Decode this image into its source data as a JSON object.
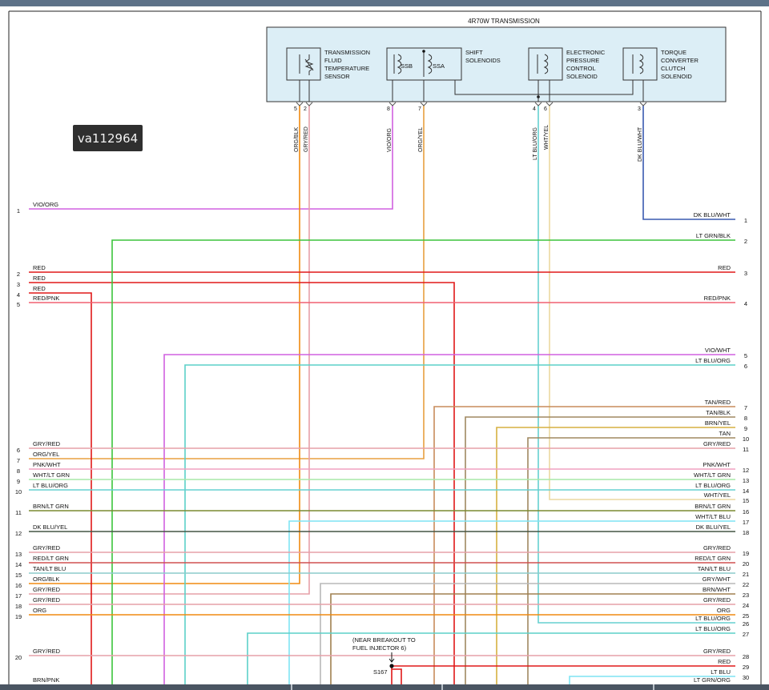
{
  "watermark": "va112964",
  "header": {
    "transmission_title": "4R70W TRANSMISSION",
    "components": [
      {
        "id": "tft",
        "lines": [
          "TRANSMISSION",
          "FLUID",
          "TEMPERATURE",
          "SENSOR"
        ]
      },
      {
        "id": "shift",
        "lines": [
          "SHIFT",
          "SOLENOIDS"
        ]
      },
      {
        "id": "epc",
        "lines": [
          "ELECTRONIC",
          "PRESSURE",
          "CONTROL",
          "SOLENOID"
        ]
      },
      {
        "id": "tcc",
        "lines": [
          "TORQUE",
          "CONVERTER",
          "CLUTCH",
          "SOLENOID"
        ]
      }
    ],
    "solenoid_labels": [
      "SSB",
      "SSA"
    ]
  },
  "pins": [
    {
      "num": "5",
      "wire": "ORG/BLK",
      "color": "#e8901a"
    },
    {
      "num": "2",
      "wire": "GRY/RED",
      "color": "#e6a0a8"
    },
    {
      "num": "8",
      "wire": "VIO/ORG",
      "color": "#e05aa8"
    },
    {
      "num": "7",
      "wire": "ORG/YEL",
      "color": "#e8a040"
    },
    {
      "num": "4",
      "wire": "LT BLU/ORG",
      "color": "#7fd8d8"
    },
    {
      "num": "6",
      "wire": "WHT/YEL",
      "color": "#ead9a0"
    },
    {
      "num": "3",
      "wire": "DK BLU/WHT",
      "color": "#4060b0"
    }
  ],
  "left_circuits": [
    {
      "num": "1",
      "label": "VIO/ORG"
    },
    {
      "num": "2",
      "label": "RED"
    },
    {
      "num": "3",
      "label": "RED"
    },
    {
      "num": "4",
      "label": "RED"
    },
    {
      "num": "5",
      "label": "RED/PNK"
    },
    {
      "num": "6",
      "label": "GRY/RED"
    },
    {
      "num": "7",
      "label": "ORG/YEL"
    },
    {
      "num": "8",
      "label": "PNK/WHT"
    },
    {
      "num": "9",
      "label": "WHT/LT GRN"
    },
    {
      "num": "10",
      "label": "LT BLU/ORG"
    },
    {
      "num": "11",
      "label": "BRN/LT GRN"
    },
    {
      "num": "12",
      "label": "DK BLU/YEL"
    },
    {
      "num": "13",
      "label": "GRY/RED"
    },
    {
      "num": "14",
      "label": "RED/LT GRN"
    },
    {
      "num": "15",
      "label": "TAN/LT BLU"
    },
    {
      "num": "16",
      "label": "ORG/BLK"
    },
    {
      "num": "17",
      "label": "GRY/RED"
    },
    {
      "num": "18",
      "label": "GRY/RED"
    },
    {
      "num": "19",
      "label": "ORG"
    },
    {
      "num": "20",
      "label": "GRY/RED"
    },
    {
      "num": "",
      "label": "BRN/PNK"
    }
  ],
  "right_circuits": [
    {
      "num": "1",
      "label": "DK BLU/WHT"
    },
    {
      "num": "2",
      "label": "LT GRN/BLK"
    },
    {
      "num": "3",
      "label": "RED"
    },
    {
      "num": "4",
      "label": "RED/PNK"
    },
    {
      "num": "5",
      "label": "VIO/WHT"
    },
    {
      "num": "6",
      "label": "LT BLU/ORG"
    },
    {
      "num": "7",
      "label": "TAN/RED"
    },
    {
      "num": "8",
      "label": "TAN/BLK"
    },
    {
      "num": "9",
      "label": "BRN/YEL"
    },
    {
      "num": "10",
      "label": "TAN"
    },
    {
      "num": "11",
      "label": "GRY/RED"
    },
    {
      "num": "12",
      "label": "PNK/WHT"
    },
    {
      "num": "13",
      "label": "WHT/LT GRN"
    },
    {
      "num": "14",
      "label": "LT BLU/ORG"
    },
    {
      "num": "15",
      "label": "WHT/YEL"
    },
    {
      "num": "16",
      "label": "BRN/LT GRN"
    },
    {
      "num": "17",
      "label": "WHT/LT BLU"
    },
    {
      "num": "18",
      "label": "DK BLU/YEL"
    },
    {
      "num": "19",
      "label": "GRY/RED"
    },
    {
      "num": "20",
      "label": "RED/LT GRN"
    },
    {
      "num": "21",
      "label": "TAN/LT BLU"
    },
    {
      "num": "22",
      "label": "GRY/WHT"
    },
    {
      "num": "23",
      "label": "BRN/WHT"
    },
    {
      "num": "24",
      "label": "GRY/RED"
    },
    {
      "num": "25",
      "label": "ORG"
    },
    {
      "num": "26",
      "label": "LT BLU/ORG"
    },
    {
      "num": "27",
      "label": "LT BLU/ORG"
    },
    {
      "num": "28",
      "label": "GRY/RED"
    },
    {
      "num": "29",
      "label": "RED"
    },
    {
      "num": "30",
      "label": "LT BLU"
    },
    {
      "num": "",
      "label": "LT GRN/ORG"
    }
  ],
  "splice": {
    "note_lines": [
      "(NEAR BREAKOUT TO",
      "FUEL INJECTOR 6)"
    ],
    "id": "S167"
  },
  "colors": {
    "red": "#e01818",
    "green": "#3cc43c",
    "pink_red": "#f06070",
    "violet": "#d060e0",
    "turquoise": "#5cd0c8",
    "orange": "#f08a10",
    "dk_blue": "#3a5ab0",
    "lt_blue": "#70e0f0"
  }
}
